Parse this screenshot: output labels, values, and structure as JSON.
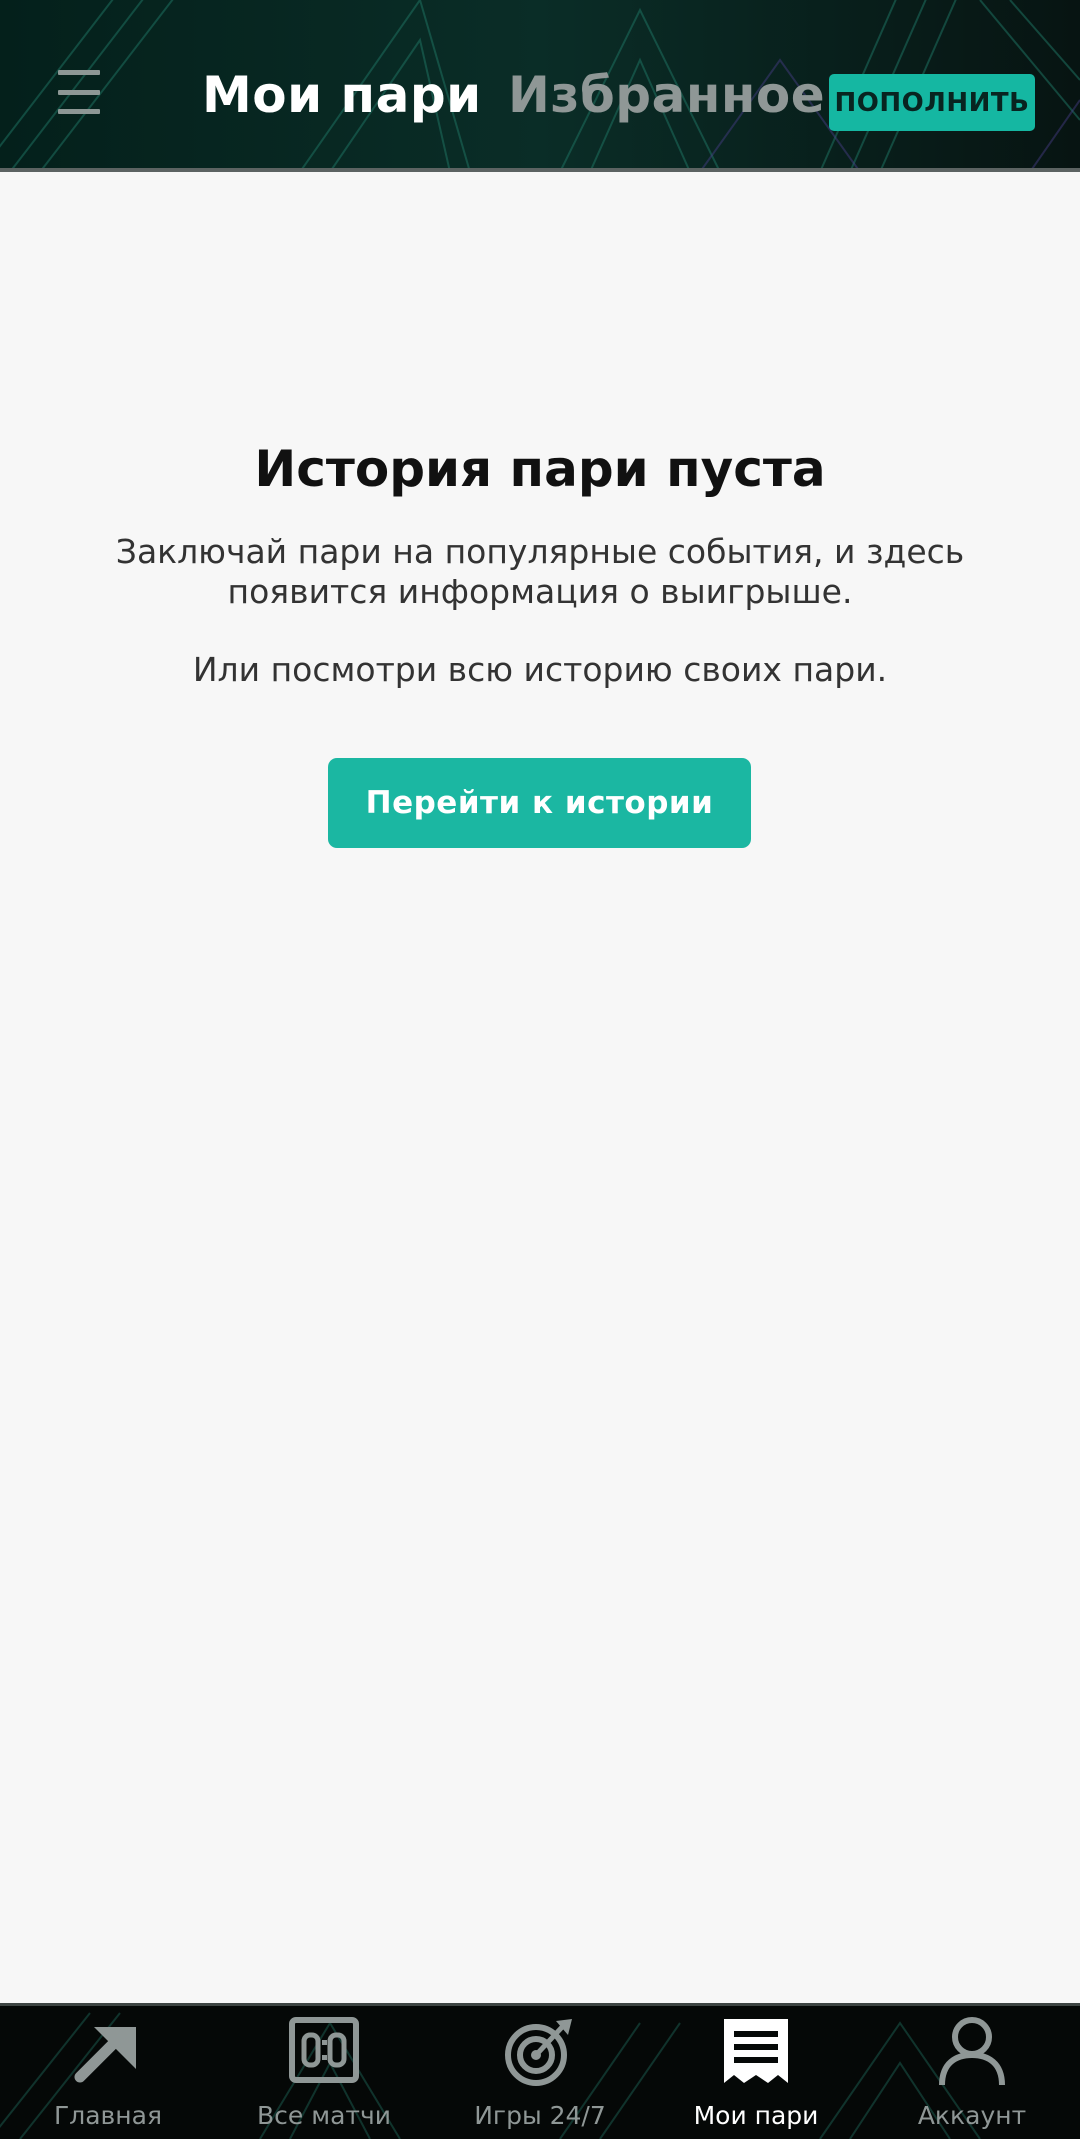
{
  "header": {
    "tabs": [
      {
        "label": "Мои пари",
        "active": true
      },
      {
        "label": "Избранное",
        "active": false
      }
    ],
    "topup_label": "ПОПОЛНИТЬ",
    "menu_icon": "hamburger-menu-icon"
  },
  "empty_state": {
    "title": "История пари пуста",
    "text": "Заключай пари на популярные события, и здесь появится информация о выигрыше.",
    "text2": "Или посмотри всю историю своих пари.",
    "button_label": "Перейти к истории"
  },
  "bottom_nav": {
    "items": [
      {
        "label": "Главная",
        "icon": "arrow-icon",
        "active": false
      },
      {
        "label": "Все матчи",
        "icon": "scoreboard-icon",
        "active": false
      },
      {
        "label": "Игры 24/7",
        "icon": "target-icon",
        "active": false
      },
      {
        "label": "Мои пари",
        "icon": "receipt-icon",
        "active": true
      },
      {
        "label": "Аккаунт",
        "icon": "user-icon",
        "active": false
      }
    ]
  },
  "colors": {
    "accent": "#1bb7a2",
    "header_bg": "#06100e",
    "page_bg": "#f7f7f7"
  }
}
